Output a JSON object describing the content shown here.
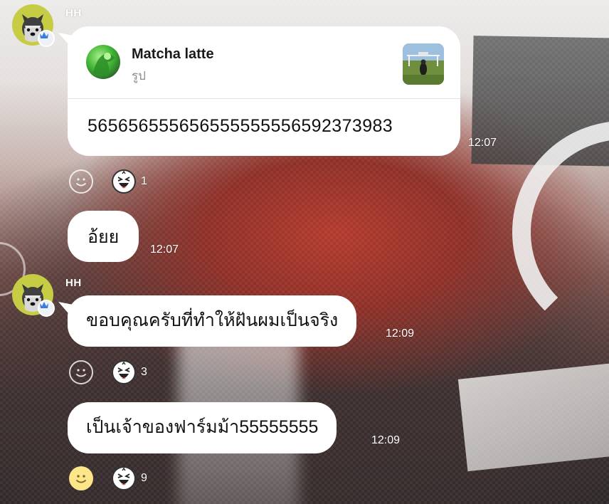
{
  "messages": [
    {
      "sender": "HH",
      "reply": {
        "name": "Matcha latte",
        "subtitle": "รูป"
      },
      "text": "565656555656555555556592373983",
      "time": "12:07",
      "reaction_count": "1"
    },
    {
      "text": "อ้ยย",
      "time": "12:07"
    },
    {
      "sender": "HH",
      "text": "ขอบคุณครับที่ทำให้ฝันผมเป็นจริง",
      "time": "12:09",
      "reaction_count": "3"
    },
    {
      "text": "เป็นเจ้าของฟาร์มม้า55555555",
      "time": "12:09",
      "reaction_count": "9"
    }
  ],
  "colors": {
    "bubble": "#ffffff",
    "avatar_bg": "#c6cc44",
    "reaction_selected": "#fde58a",
    "crown": "#3b7ddd"
  },
  "icons": {
    "avatar": "schnauzer-dog-icon",
    "badge": "crown-icon",
    "add_reaction": "smiley-icon",
    "reaction": "laughing-face-icon"
  }
}
